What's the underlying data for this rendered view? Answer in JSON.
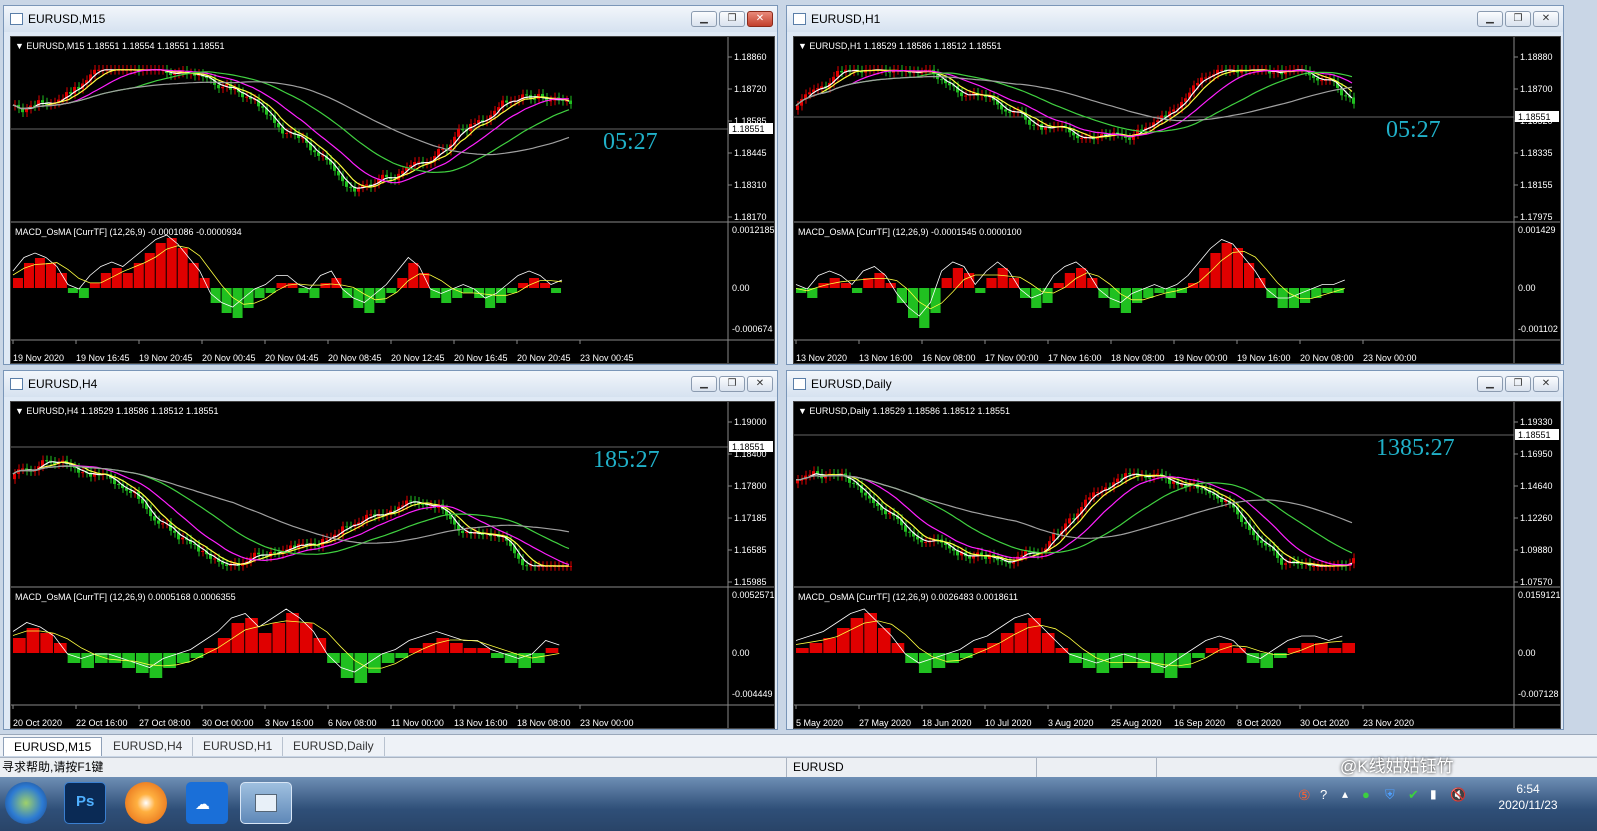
{
  "windows": [
    {
      "title": "EURUSD,M15",
      "info": "EURUSD,M15  1.18551 1.18554 1.18551 1.18551",
      "bid": "1.18551",
      "timer": "05:27",
      "prices": [
        "1.18860",
        "1.18720",
        "1.18585",
        "1.18445",
        "1.18310",
        "1.18170"
      ],
      "macd_label": "MACD_OsMA [CurrTF] (12,26,9) -0.0001086 -0.0000934",
      "macd_ticks": [
        "0.0012185",
        "0.00",
        "-0.000674"
      ],
      "times": [
        "19 Nov 2020",
        "19 Nov 16:45",
        "19 Nov 20:45",
        "20 Nov 00:45",
        "20 Nov 04:45",
        "20 Nov 08:45",
        "20 Nov 12:45",
        "20 Nov 16:45",
        "20 Nov 20:45",
        "23 Nov 00:45"
      ],
      "bars": [
        0.2,
        0.5,
        0.6,
        0.5,
        0.3,
        -0.1,
        -0.2,
        0.1,
        0.3,
        0.4,
        0.3,
        0.5,
        0.7,
        0.9,
        1.0,
        0.8,
        0.5,
        0.2,
        -0.3,
        -0.5,
        -0.6,
        -0.4,
        -0.2,
        -0.1,
        0.1,
        0.1,
        -0.1,
        -0.2,
        0.1,
        0.2,
        -0.2,
        -0.4,
        -0.5,
        -0.3,
        -0.1,
        0.2,
        0.5,
        0.3,
        -0.2,
        -0.3,
        -0.2,
        -0.1,
        -0.2,
        -0.4,
        -0.3,
        -0.1,
        0.1,
        0.2,
        0.1,
        -0.1,
        0.0
      ]
    },
    {
      "title": "EURUSD,H1",
      "info": "EURUSD,H1  1.18529 1.18586 1.18512 1.18551",
      "bid": "1.18551",
      "timer": "05:27",
      "prices": [
        "1.18880",
        "1.18700",
        "1.18520",
        "1.18335",
        "1.18155",
        "1.17975"
      ],
      "macd_label": "MACD_OsMA [CurrTF] (12,26,9) -0.0001545 0.0000100",
      "macd_ticks": [
        "0.001429",
        "0.00",
        "-0.001102"
      ],
      "times": [
        "13 Nov 2020",
        "13 Nov 16:00",
        "16 Nov 08:00",
        "17 Nov 00:00",
        "17 Nov 16:00",
        "18 Nov 08:00",
        "19 Nov 00:00",
        "19 Nov 16:00",
        "20 Nov 08:00",
        "23 Nov 00:00"
      ],
      "bars": [
        -0.1,
        -0.2,
        0.1,
        0.2,
        0.1,
        -0.1,
        0.2,
        0.3,
        0.1,
        -0.3,
        -0.6,
        -0.8,
        -0.5,
        0.2,
        0.4,
        0.3,
        -0.1,
        0.2,
        0.4,
        0.2,
        -0.2,
        -0.4,
        -0.3,
        0.1,
        0.3,
        0.4,
        0.2,
        -0.2,
        -0.4,
        -0.5,
        -0.3,
        -0.2,
        -0.1,
        -0.2,
        -0.1,
        0.1,
        0.4,
        0.7,
        0.9,
        0.8,
        0.5,
        0.2,
        -0.2,
        -0.4,
        -0.4,
        -0.3,
        -0.2,
        -0.1,
        -0.1,
        0.0
      ]
    },
    {
      "title": "EURUSD,H4",
      "info": "EURUSD,H4  1.18529 1.18586 1.18512 1.18551",
      "bid": "1.18551",
      "timer": "185:27",
      "prices": [
        "1.19000",
        "1.18400",
        "1.17800",
        "1.17185",
        "1.16585",
        "1.15985"
      ],
      "macd_label": "MACD_OsMA [CurrTF] (12,26,9) 0.0005168 0.0006355",
      "macd_ticks": [
        "0.0052571",
        "0.00",
        "-0.004449"
      ],
      "times": [
        "20 Oct 2020",
        "22 Oct 16:00",
        "27 Oct 08:00",
        "30 Oct 00:00",
        "3 Nov 16:00",
        "6 Nov 08:00",
        "11 Nov 00:00",
        "13 Nov 16:00",
        "18 Nov 08:00",
        "23 Nov 00:00"
      ],
      "bars": [
        0.3,
        0.5,
        0.4,
        0.2,
        -0.2,
        -0.3,
        -0.2,
        -0.2,
        -0.3,
        -0.4,
        -0.5,
        -0.3,
        -0.2,
        -0.1,
        0.1,
        0.3,
        0.6,
        0.7,
        0.4,
        0.6,
        0.8,
        0.6,
        0.3,
        -0.2,
        -0.5,
        -0.6,
        -0.4,
        -0.2,
        -0.1,
        0.1,
        0.2,
        0.3,
        0.2,
        0.1,
        0.1,
        -0.1,
        -0.2,
        -0.3,
        -0.2,
        0.1,
        0.0
      ]
    },
    {
      "title": "EURUSD,Daily",
      "info": "EURUSD,Daily  1.18529 1.18586 1.18512 1.18551",
      "bid": "1.18551",
      "timer": "1385:27",
      "prices": [
        "1.19330",
        "1.16950",
        "1.14640",
        "1.12260",
        "1.09880",
        "1.07570"
      ],
      "macd_label": "MACD_OsMA [CurrTF] (12,26,9) 0.0026483 0.0018611",
      "macd_ticks": [
        "0.0159121",
        "0.00",
        "-0.007128"
      ],
      "times": [
        "5 May 2020",
        "27 May 2020",
        "18 Jun 2020",
        "10 Jul 2020",
        "3 Aug 2020",
        "25 Aug 2020",
        "16 Sep 2020",
        "8 Oct 2020",
        "30 Oct 2020",
        "23 Nov 2020"
      ],
      "bars": [
        0.1,
        0.2,
        0.3,
        0.5,
        0.7,
        0.8,
        0.5,
        0.2,
        -0.2,
        -0.4,
        -0.3,
        -0.2,
        -0.1,
        0.1,
        0.2,
        0.4,
        0.6,
        0.7,
        0.4,
        0.1,
        -0.2,
        -0.3,
        -0.4,
        -0.3,
        -0.2,
        -0.3,
        -0.4,
        -0.5,
        -0.3,
        -0.1,
        0.1,
        0.2,
        0.1,
        -0.2,
        -0.3,
        -0.1,
        0.1,
        0.2,
        0.2,
        0.1,
        0.2
      ]
    }
  ],
  "tabs": [
    "EURUSD,M15",
    "EURUSD,H4",
    "EURUSD,H1",
    "EURUSD,Daily"
  ],
  "status": {
    "help": "寻求帮助,请按F1键",
    "symbol": "EURUSD"
  },
  "watermark": "@K线姑姑钰竹",
  "taskbar": {
    "time": "6:54",
    "date": "2020/11/23",
    "ps": "Ps"
  },
  "colors": {
    "bull": "#e00000",
    "bear": "#20c020",
    "timer": "#20b0c8",
    "ma_fast": "#ffffff",
    "ma_mid": "#ffff40",
    "ma_slow": "#ff20ff",
    "ma_green": "#40d040",
    "ma_gray": "#a0a0a0"
  }
}
